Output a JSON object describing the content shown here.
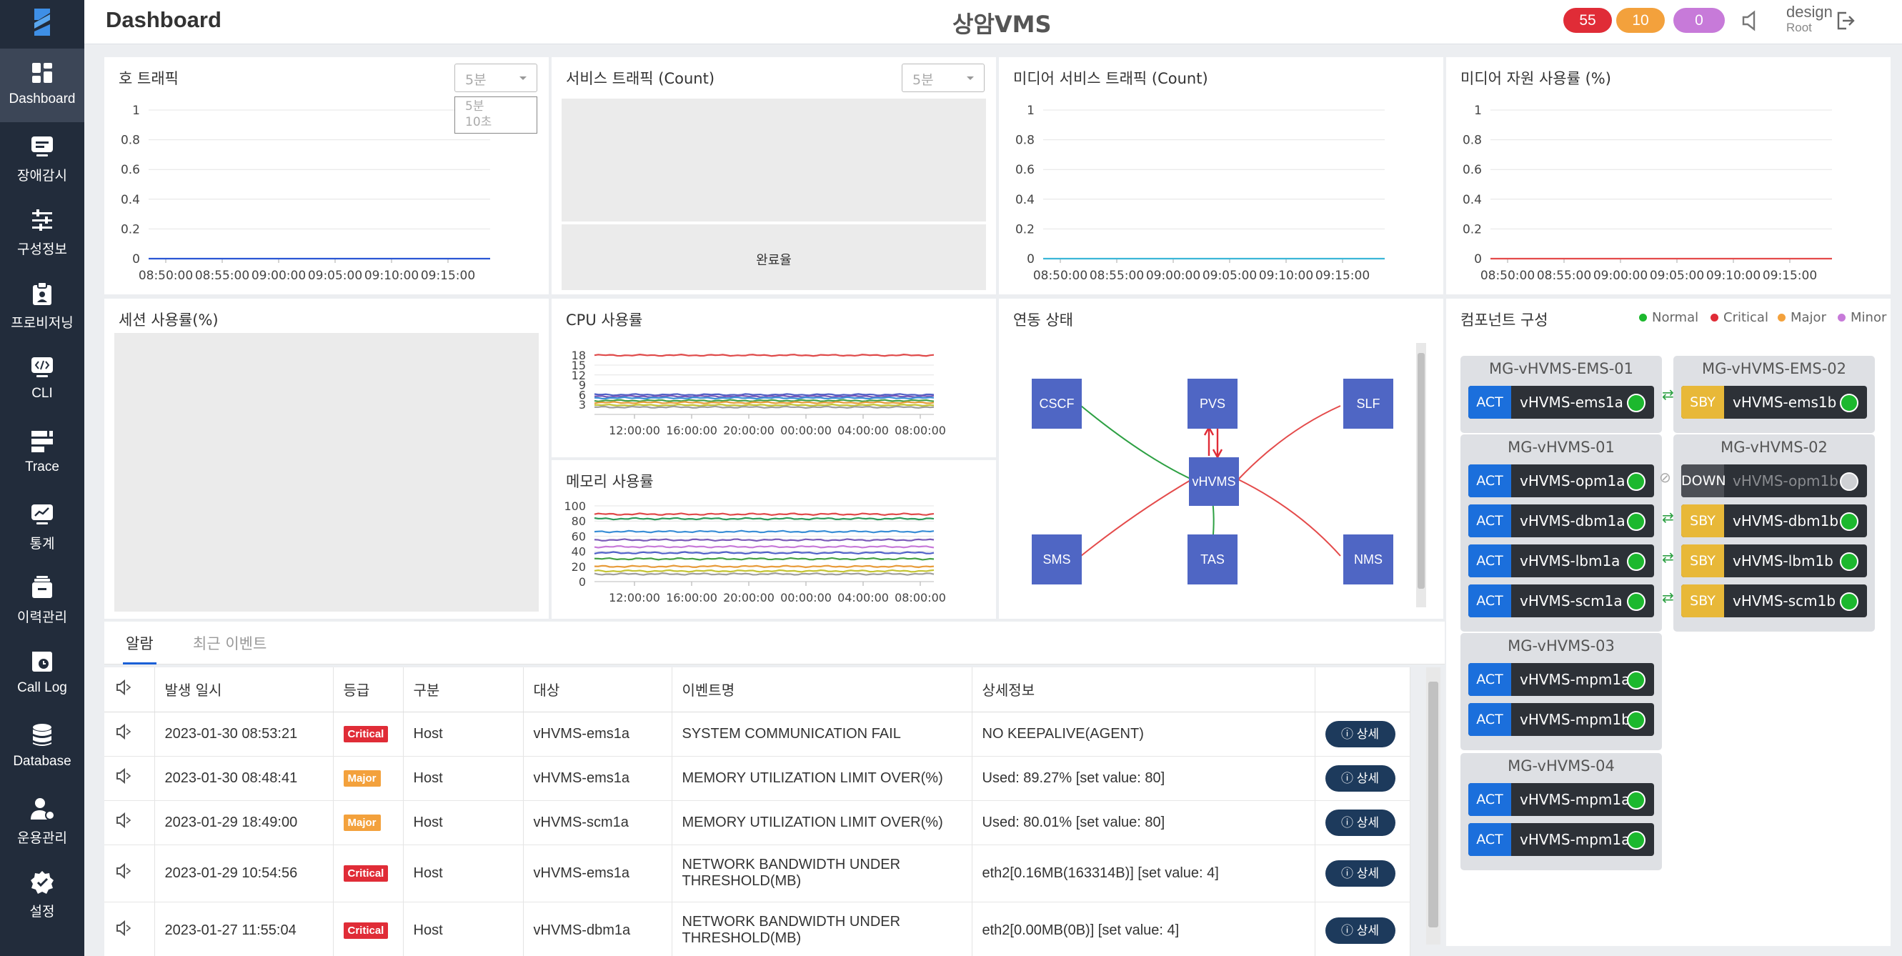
{
  "app": {
    "page_title": "Dashboard",
    "system_title": "상암VMS",
    "user_name": "design",
    "user_role": "Root"
  },
  "alarm_counts": {
    "critical": "55",
    "major": "10",
    "minor": "0"
  },
  "colors": {
    "sidebar": "#222c3b",
    "critical": "#e02c37",
    "major": "#f3a13c",
    "minor": "#c77ad9",
    "act": "#1b6fdc",
    "sby": "#e8b838",
    "normal": "#1cb82e",
    "node": "#4f66c4"
  },
  "sidebar": {
    "items": [
      {
        "label": "Dashboard",
        "icon": "dashboard-icon"
      },
      {
        "label": "장애감시",
        "icon": "monitor-icon"
      },
      {
        "label": "구성정보",
        "icon": "sliders-icon"
      },
      {
        "label": "프로비저닝",
        "icon": "provision-icon"
      },
      {
        "label": "CLI",
        "icon": "code-icon"
      },
      {
        "label": "Trace",
        "icon": "trace-icon"
      },
      {
        "label": "통계",
        "icon": "stats-icon"
      },
      {
        "label": "이력관리",
        "icon": "history-icon"
      },
      {
        "label": "Call Log",
        "icon": "calllog-icon"
      },
      {
        "label": "Database",
        "icon": "database-icon"
      },
      {
        "label": "운용관리",
        "icon": "operator-icon"
      },
      {
        "label": "설정",
        "icon": "settings-icon"
      }
    ]
  },
  "panels": {
    "call_traffic": {
      "title": "호 트래픽",
      "interval": "5분",
      "options": [
        "5분",
        "10초"
      ]
    },
    "service_traffic": {
      "title": "서비스 트래픽 (Count)",
      "interval": "5분",
      "completion_label": "완료율"
    },
    "media_service_traffic": {
      "title": "미디어 서비스 트래픽 (Count)"
    },
    "media_resource": {
      "title": "미디어 자원 사용률 (%)"
    },
    "session": {
      "title": "세션 사용률(%)"
    },
    "cpu": {
      "title": "CPU 사용률"
    },
    "memory": {
      "title": "메모리 사용률"
    },
    "link": {
      "title": "연동 상태",
      "center": "vHVMS",
      "nodes": [
        "CSCF",
        "PVS",
        "SLF",
        "SMS",
        "TAS",
        "NMS"
      ]
    },
    "components": {
      "title": "컴포넌트 구성",
      "legend": [
        "Normal",
        "Critical",
        "Major",
        "Minor"
      ]
    }
  },
  "chart_data": [
    {
      "type": "line",
      "title": "호 트래픽",
      "x": [
        "08:50:00",
        "08:55:00",
        "09:00:00",
        "09:05:00",
        "09:10:00",
        "09:15:00"
      ],
      "ylim": [
        0,
        1
      ],
      "yticks": [
        "1",
        "0.8",
        "0.6",
        "0.4",
        "0.2",
        "0"
      ],
      "series": [
        {
          "values": [
            0,
            0,
            0,
            0,
            0,
            0
          ],
          "color": "#2a56d4"
        }
      ]
    },
    {
      "type": "line",
      "title": "미디어 서비스 트래픽 (Count)",
      "x": [
        "08:50:00",
        "08:55:00",
        "09:00:00",
        "09:05:00",
        "09:10:00",
        "09:15:00"
      ],
      "ylim": [
        0,
        1
      ],
      "yticks": [
        "1",
        "0.8",
        "0.6",
        "0.4",
        "0.2",
        "0"
      ],
      "series": [
        {
          "values": [
            0,
            0,
            0,
            0,
            0,
            0
          ],
          "color": "#3bb6d8"
        }
      ]
    },
    {
      "type": "line",
      "title": "미디어 자원 사용률 (%)",
      "x": [
        "08:50:00",
        "08:55:00",
        "09:00:00",
        "09:05:00",
        "09:10:00",
        "09:15:00"
      ],
      "ylim": [
        0,
        1
      ],
      "yticks": [
        "1",
        "0.8",
        "0.6",
        "0.4",
        "0.2",
        "0"
      ],
      "series": [
        {
          "values": [
            0,
            0,
            0,
            0,
            0,
            0
          ],
          "color": "#e44b4b"
        }
      ]
    },
    {
      "type": "line",
      "title": "CPU 사용률",
      "x": [
        "12:00:00",
        "16:00:00",
        "20:00:00",
        "00:00:00",
        "04:00:00",
        "08:00:00"
      ],
      "ylim": [
        0,
        20
      ],
      "yticks": [
        "18",
        "15",
        "12",
        "9",
        "6",
        "3"
      ],
      "series": [
        {
          "value": 18,
          "color": "#e04a4a"
        },
        {
          "value": 6,
          "color": "#5060c8"
        },
        {
          "value": 5.5,
          "color": "#7b5bb8"
        },
        {
          "value": 5,
          "color": "#3a8fd6"
        },
        {
          "value": 4.2,
          "color": "#45a145"
        },
        {
          "value": 3.6,
          "color": "#e89c3a"
        },
        {
          "value": 2.8,
          "color": "#c5c534"
        },
        {
          "value": 2.2,
          "color": "#9e9e9e"
        }
      ]
    },
    {
      "type": "line",
      "title": "메모리 사용률",
      "x": [
        "12:00:00",
        "16:00:00",
        "20:00:00",
        "00:00:00",
        "04:00:00",
        "08:00:00"
      ],
      "ylim": [
        0,
        100
      ],
      "yticks": [
        "100",
        "80",
        "60",
        "40",
        "20",
        "0"
      ],
      "series": [
        {
          "value": 89,
          "color": "#e04a4a"
        },
        {
          "value": 83,
          "color": "#2d9b5a"
        },
        {
          "value": 66,
          "color": "#3a8fd6"
        },
        {
          "value": 55,
          "color": "#7b5bb8"
        },
        {
          "value": 46,
          "color": "#c77ad9"
        },
        {
          "value": 38,
          "color": "#5060c8"
        },
        {
          "value": 30,
          "color": "#45a145"
        },
        {
          "value": 20,
          "color": "#e89c3a"
        },
        {
          "value": 14,
          "color": "#c5c534"
        },
        {
          "value": 10,
          "color": "#9e9e9e"
        }
      ]
    }
  ],
  "groups": [
    {
      "name": "MG-vHVMS-EMS-01",
      "nodes": [
        {
          "state": "ACT",
          "name": "vHVMS-ems1a"
        }
      ]
    },
    {
      "name": "MG-vHVMS-EMS-02",
      "nodes": [
        {
          "state": "SBY",
          "name": "vHVMS-ems1b"
        }
      ]
    },
    {
      "name": "MG-vHVMS-01",
      "nodes": [
        {
          "state": "ACT",
          "name": "vHVMS-opm1a"
        },
        {
          "state": "ACT",
          "name": "vHVMS-dbm1a"
        },
        {
          "state": "ACT",
          "name": "vHVMS-lbm1a"
        },
        {
          "state": "ACT",
          "name": "vHVMS-scm1a"
        }
      ]
    },
    {
      "name": "MG-vHVMS-02",
      "nodes": [
        {
          "state": "DOWN",
          "name": "vHVMS-opm1b"
        },
        {
          "state": "SBY",
          "name": "vHVMS-dbm1b"
        },
        {
          "state": "SBY",
          "name": "vHVMS-lbm1b"
        },
        {
          "state": "SBY",
          "name": "vHVMS-scm1b"
        }
      ]
    },
    {
      "name": "MG-vHVMS-03",
      "nodes": [
        {
          "state": "ACT",
          "name": "vHVMS-mpm1a"
        },
        {
          "state": "ACT",
          "name": "vHVMS-mpm1b"
        }
      ]
    },
    {
      "name": "MG-vHVMS-04",
      "nodes": [
        {
          "state": "ACT",
          "name": "vHVMS-mpm1a"
        },
        {
          "state": "ACT",
          "name": "vHVMS-mpm1a"
        }
      ]
    }
  ],
  "alarm_tabs": [
    "알람",
    "최근 이벤트"
  ],
  "alarm_table": {
    "headers": [
      "발생 일시",
      "등급",
      "구분",
      "대상",
      "이벤트명",
      "상세정보"
    ],
    "detail_label": "상세",
    "rows": [
      {
        "time": "2023-01-30 08:53:21",
        "grade": "Critical",
        "type": "Host",
        "target": "vHVMS-ems1a",
        "event": "SYSTEM COMMUNICATION FAIL",
        "detail": "NO KEEPALIVE(AGENT)"
      },
      {
        "time": "2023-01-30 08:48:41",
        "grade": "Major",
        "type": "Host",
        "target": "vHVMS-ems1a",
        "event": "MEMORY UTILIZATION LIMIT OVER(%)",
        "detail": "Used: 89.27% [set value: 80]"
      },
      {
        "time": "2023-01-29 18:49:00",
        "grade": "Major",
        "type": "Host",
        "target": "vHVMS-scm1a",
        "event": "MEMORY UTILIZATION LIMIT OVER(%)",
        "detail": "Used: 80.01% [set value: 80]"
      },
      {
        "time": "2023-01-29 10:54:56",
        "grade": "Critical",
        "type": "Host",
        "target": "vHVMS-ems1a",
        "event": "NETWORK BANDWIDTH UNDER THRESHOLD(MB)",
        "detail": "eth2[0.16MB(163314B)] [set value: 4]"
      },
      {
        "time": "2023-01-27 11:55:04",
        "grade": "Critical",
        "type": "Host",
        "target": "vHVMS-dbm1a",
        "event": "NETWORK BANDWIDTH UNDER THRESHOLD(MB)",
        "detail": "eth2[0.00MB(0B)] [set value: 4]"
      }
    ]
  }
}
